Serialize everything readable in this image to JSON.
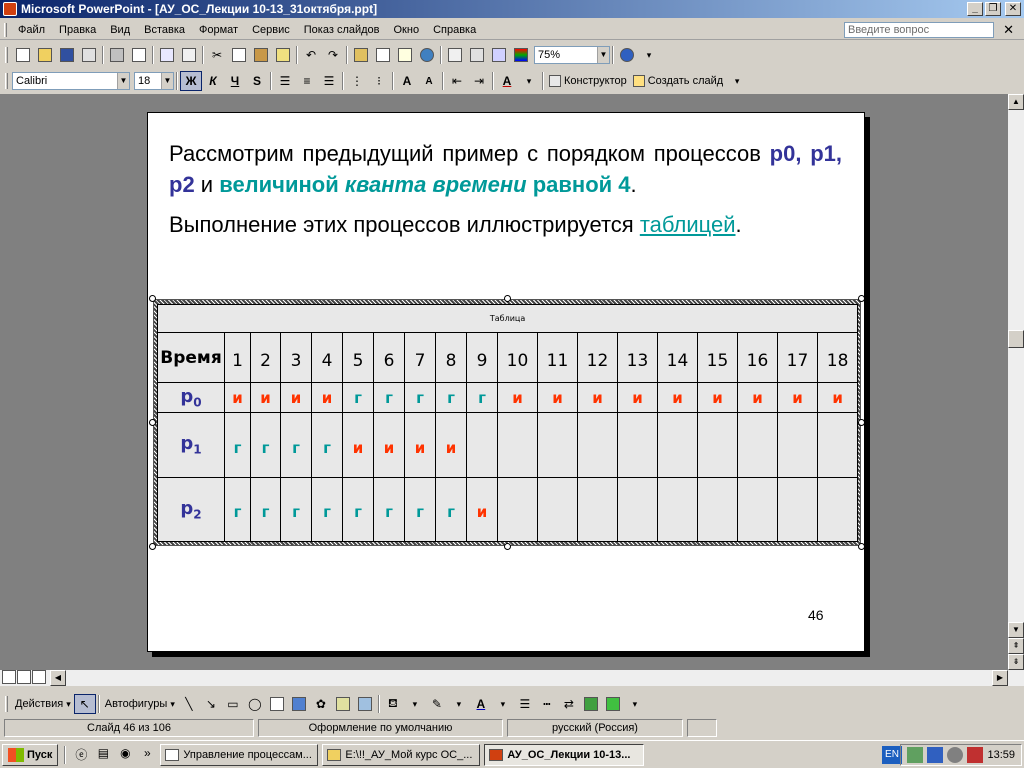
{
  "window": {
    "title": "Microsoft PowerPoint - [АУ_ОС_Лекции 10-13_31октября.ppt]",
    "minimize": "_",
    "restore": "❐",
    "close": "✕"
  },
  "menubar": {
    "items": [
      "Файл",
      "Правка",
      "Вид",
      "Вставка",
      "Формат",
      "Сервис",
      "Показ слайдов",
      "Окно",
      "Справка"
    ],
    "help_placeholder": "Введите вопрос",
    "close": "✕"
  },
  "toolbar": {
    "zoom": "75%",
    "font": "Calibri",
    "font_size": "18",
    "bold": "Ж",
    "italic": "К",
    "underline": "Ч",
    "shadow": "S",
    "designer": "Конструктор",
    "new_slide": "Создать слайд"
  },
  "slide": {
    "para1": {
      "t1": "Рассмотрим предыдущий пример с порядком процессов ",
      "t2": "p0, p1, p2",
      "t3": " и ",
      "t4": "величиной ",
      "t5": "кванта времени",
      "t6": " равной 4",
      "t7": "."
    },
    "para2": {
      "t1": "Выполнение этих процессов иллюстрируется ",
      "link": "таблицей",
      "t2": "."
    },
    "page_number": "46",
    "table": {
      "caption": "Таблица",
      "time_label": "Время",
      "times": [
        "1",
        "2",
        "3",
        "4",
        "5",
        "6",
        "7",
        "8",
        "9",
        "10",
        "11",
        "12",
        "13",
        "14",
        "15",
        "16",
        "17",
        "18"
      ],
      "rows": [
        {
          "label": "p",
          "sub": "0",
          "cells": [
            "и",
            "и",
            "и",
            "и",
            "г",
            "г",
            "г",
            "г",
            "г",
            "и",
            "и",
            "и",
            "и",
            "и",
            "и",
            "и",
            "и",
            "и"
          ]
        },
        {
          "label": "p",
          "sub": "1",
          "cells": [
            "г",
            "г",
            "г",
            "г",
            "и",
            "и",
            "и",
            "и",
            "",
            "",
            "",
            "",
            "",
            "",
            "",
            "",
            "",
            ""
          ]
        },
        {
          "label": "p",
          "sub": "2",
          "cells": [
            "г",
            "г",
            "г",
            "г",
            "г",
            "г",
            "г",
            "г",
            "и",
            "",
            "",
            "",
            "",
            "",
            "",
            "",
            "",
            ""
          ]
        }
      ]
    }
  },
  "drawbar": {
    "actions": "Действия",
    "autoshapes": "Автофигуры"
  },
  "statusbar": {
    "slide_info": "Слайд 46 из 106",
    "design": "Оформление по умолчанию",
    "language": "русский (Россия)"
  },
  "taskbar": {
    "start": "Пуск",
    "tasks": [
      "Управление процессам...",
      "E:\\!!_АУ_Мой курс ОС_...",
      "АУ_ОС_Лекции 10-13..."
    ],
    "lang": "EN",
    "clock": "13:59"
  },
  "colors": {
    "accent_blue": "#333399",
    "teal": "#009999",
    "orange_red": "#ff3300"
  }
}
